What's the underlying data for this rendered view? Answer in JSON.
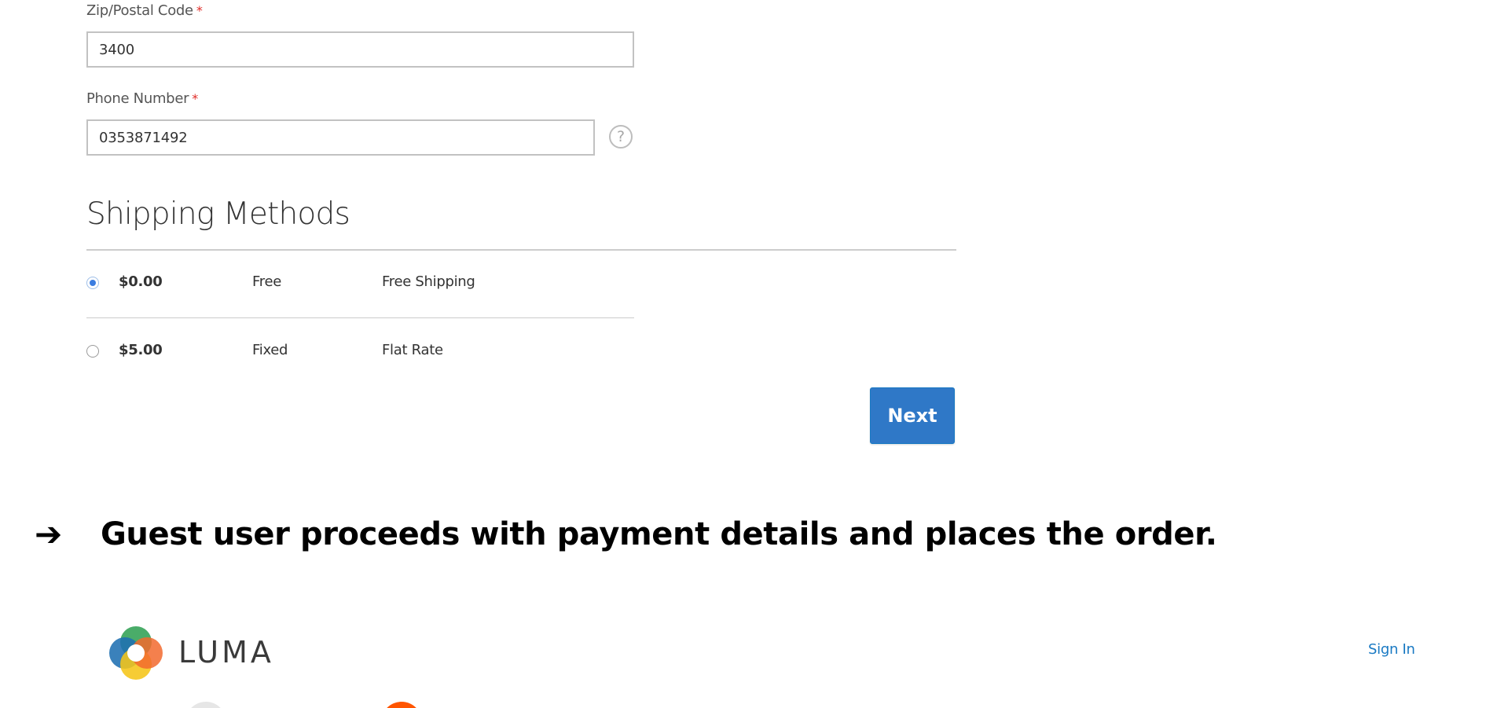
{
  "form": {
    "zip": {
      "label": "Zip/Postal Code",
      "required_mark": "*",
      "value": "3400"
    },
    "phone": {
      "label": "Phone Number",
      "required_mark": "*",
      "value": "0353871492",
      "help_glyph": "?"
    }
  },
  "shipping": {
    "title": "Shipping Methods",
    "methods": [
      {
        "price": "$0.00",
        "type": "Free",
        "carrier": "Free Shipping",
        "selected": true
      },
      {
        "price": "$5.00",
        "type": "Fixed",
        "carrier": "Flat Rate",
        "selected": false
      }
    ],
    "next_label": "Next"
  },
  "step": {
    "arrow": "➔",
    "text": "Guest user proceeds with payment details and places the order."
  },
  "header": {
    "brand": "LUMA",
    "sign_in_label": "Sign In"
  },
  "colors": {
    "accent": "#1979c3",
    "required": "#e02b27",
    "progress_inactive": "#e6e6e6",
    "progress_active": "#ff5501",
    "logo_green": "#3ba55c",
    "logo_blue": "#1f6fb2",
    "logo_yellow": "#f5c518",
    "logo_orange": "#f26a2e"
  },
  "icons": {
    "help": "question-mark-circle-icon",
    "logo": "luma-logo-icon",
    "radio_selected": "radio-checked-icon",
    "radio_unselected": "radio-unchecked-icon"
  }
}
